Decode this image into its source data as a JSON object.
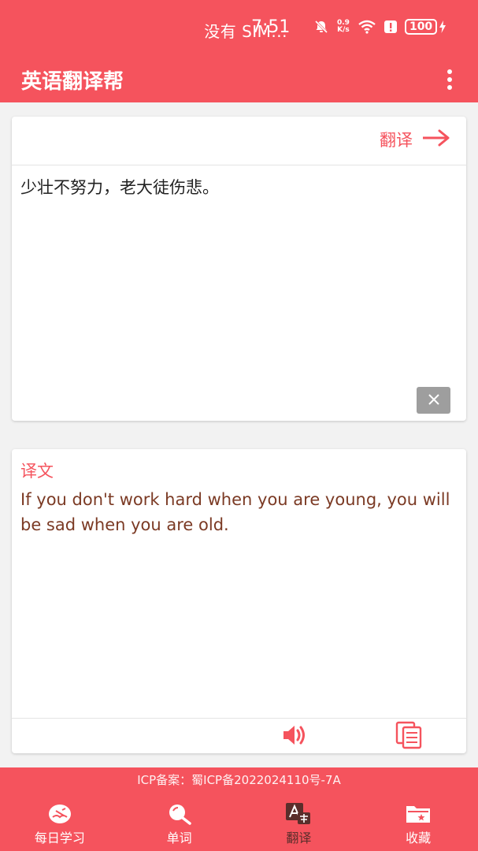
{
  "status_bar": {
    "carrier": "没有 SIM...",
    "time": "7:51",
    "net_speed_value": "0.9",
    "net_speed_unit": "K/s",
    "battery": "100"
  },
  "app_bar": {
    "title": "英语翻译帮",
    "menu_icon": "more-vert-icon"
  },
  "input_card": {
    "translate_label": "翻译",
    "source_text": "少壮不努力，老大徒伤悲。",
    "clear_icon": "close-icon"
  },
  "output_card": {
    "label": "译文",
    "translation": "If you don't work hard when you are young, you will be sad when you are old.",
    "speaker_icon": "speaker-icon",
    "copy_icon": "copy-icon"
  },
  "footer": {
    "icp": "ICP备案：蜀ICP备2022024110号-7A"
  },
  "nav": {
    "items": [
      {
        "label": "每日学习",
        "icon": "book-icon"
      },
      {
        "label": "单词",
        "icon": "magnifier-icon"
      },
      {
        "label": "翻译",
        "icon": "translate-icon"
      },
      {
        "label": "收藏",
        "icon": "folder-star-icon"
      }
    ],
    "active_index": 2
  },
  "colors": {
    "primary": "#f5535d",
    "output_text": "#7b3a24",
    "active_nav": "#5a2e2b"
  }
}
